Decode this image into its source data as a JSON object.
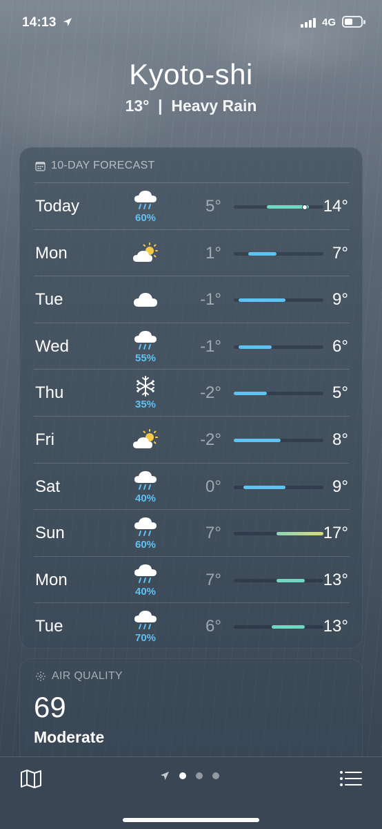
{
  "status_bar": {
    "time": "14:13",
    "network": "4G"
  },
  "header": {
    "city": "Kyoto-shi",
    "current": "13°  |  Heavy Rain"
  },
  "forecast": {
    "title": "10-DAY FORECAST",
    "scale": {
      "min": -2,
      "max": 17
    },
    "current_temp": 13,
    "days": [
      {
        "day": "Today",
        "icon": "rain-cloud-icon",
        "precip": "60%",
        "lo_text": "5°",
        "hi_text": "14°",
        "lo": 5,
        "hi": 14,
        "color": "#6fd6c0"
      },
      {
        "day": "Mon",
        "icon": "partly-sunny-icon",
        "precip": "",
        "lo_text": "1°",
        "hi_text": "7°",
        "lo": 1,
        "hi": 7,
        "color": "#5ec3f2"
      },
      {
        "day": "Tue",
        "icon": "cloud-icon",
        "precip": "",
        "lo_text": "-1°",
        "hi_text": "9°",
        "lo": -1,
        "hi": 9,
        "color": "#5ec3f2"
      },
      {
        "day": "Wed",
        "icon": "rain-cloud-icon",
        "precip": "55%",
        "lo_text": "-1°",
        "hi_text": "6°",
        "lo": -1,
        "hi": 6,
        "color": "#5ec3f2"
      },
      {
        "day": "Thu",
        "icon": "snowflake-icon",
        "precip": "35%",
        "lo_text": "-2°",
        "hi_text": "5°",
        "lo": -2,
        "hi": 5,
        "color": "#5ec3f2"
      },
      {
        "day": "Fri",
        "icon": "partly-sunny-icon",
        "precip": "",
        "lo_text": "-2°",
        "hi_text": "8°",
        "lo": -2,
        "hi": 8,
        "color": "#5ec3f2"
      },
      {
        "day": "Sat",
        "icon": "rain-cloud-icon",
        "precip": "40%",
        "lo_text": "0°",
        "hi_text": "9°",
        "lo": 0,
        "hi": 9,
        "color": "#5ec3f2"
      },
      {
        "day": "Sun",
        "icon": "rain-cloud-icon",
        "precip": "60%",
        "lo_text": "7°",
        "hi_text": "17°",
        "lo": 7,
        "hi": 17,
        "color": "#b8d890"
      },
      {
        "day": "Mon",
        "icon": "rain-cloud-icon",
        "precip": "40%",
        "lo_text": "7°",
        "hi_text": "13°",
        "lo": 7,
        "hi": 13,
        "color": "#6fd6c0"
      },
      {
        "day": "Tue",
        "icon": "rain-cloud-icon",
        "precip": "70%",
        "lo_text": "6°",
        "hi_text": "13°",
        "lo": 6,
        "hi": 13,
        "color": "#6fd6c0"
      }
    ]
  },
  "air_quality": {
    "title": "AIR QUALITY",
    "value": "69",
    "description": "Moderate"
  },
  "bottom_bar": {
    "pages": 3,
    "active_page": 0
  }
}
